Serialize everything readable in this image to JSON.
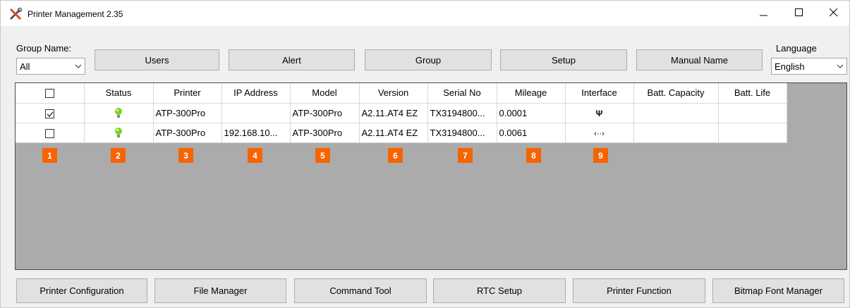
{
  "window": {
    "title": "Printer Management 2.35",
    "controls": {
      "minimize": "—",
      "maximize": "☐",
      "close": "✕"
    }
  },
  "toolbar": {
    "group_name_label": "Group Name:",
    "group_value": "All",
    "language_label": "Language",
    "language_value": "English",
    "buttons": [
      "Users",
      "Alert",
      "Group",
      "Setup",
      "Manual Name"
    ]
  },
  "grid": {
    "columns": [
      "",
      "Status",
      "Printer",
      "IP Address",
      "Model",
      "Version",
      "Serial No",
      "Mileage",
      "Interface",
      "Batt. Capacity",
      "Batt. Life"
    ],
    "rows": [
      {
        "checked": true,
        "status": "online",
        "printer": "ATP-300Pro",
        "ip": "",
        "model": "ATP-300Pro",
        "version": "A2.11.AT4 EZ",
        "serial": "TX3194800...",
        "mileage": "0.0001",
        "interface_icon": "usb-icon",
        "interface_glyph": "Ψ",
        "batt_capacity": "",
        "batt_life": ""
      },
      {
        "checked": false,
        "status": "online",
        "printer": "ATP-300Pro",
        "ip": "192.168.10...",
        "model": "ATP-300Pro",
        "version": "A2.11.AT4 EZ",
        "serial": "TX3194800...",
        "mileage": "0.0061",
        "interface_icon": "network-icon",
        "interface_glyph": "‹··›",
        "batt_capacity": "",
        "batt_life": ""
      }
    ]
  },
  "badges": [
    "1",
    "2",
    "3",
    "4",
    "5",
    "6",
    "7",
    "8",
    "9"
  ],
  "bottom_buttons": [
    "Printer Configuration",
    "File Manager",
    "Command Tool",
    "RTC Setup",
    "Printer Function",
    "Bitmap Font Manager"
  ],
  "colors": {
    "badge": "#f76300",
    "status_bulb": "#7ed321",
    "grid_background": "#ababab"
  }
}
